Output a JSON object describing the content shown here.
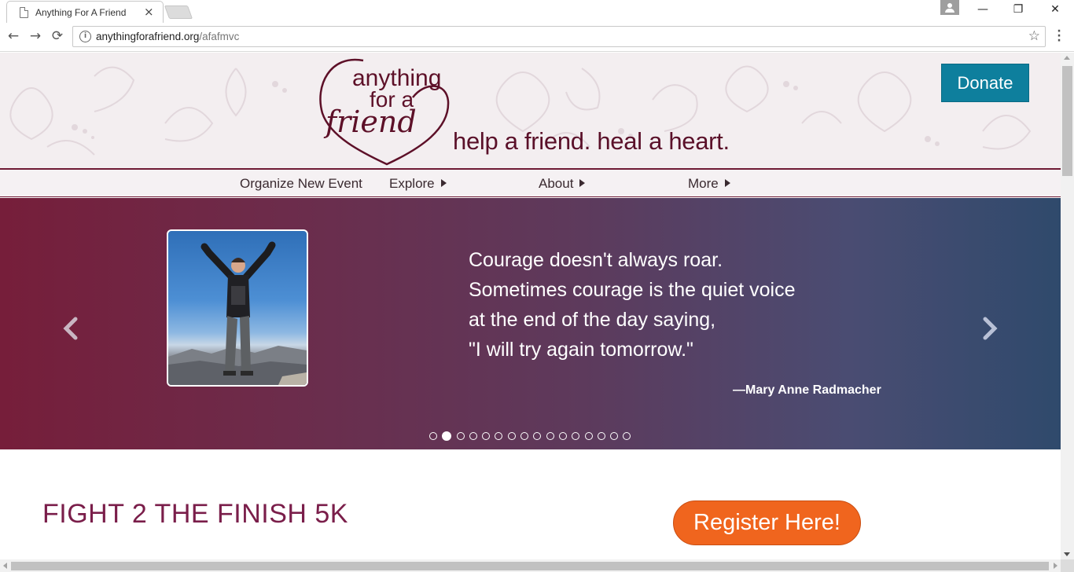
{
  "browser": {
    "tab_title": "Anything For A Friend",
    "close_glyph": "×",
    "url_host": "anythingforafriend.org",
    "url_path": "/afafmvc",
    "info_glyph": "i",
    "star_glyph": "☆",
    "back_glyph": "←",
    "forward_glyph": "→",
    "reload_glyph": "⟳",
    "minimize_glyph": "—",
    "maximize_glyph": "❐",
    "window_close_glyph": "✕"
  },
  "header": {
    "logo": {
      "line1": "anything",
      "line2": "for a",
      "line3": "friend"
    },
    "tagline": "help a friend.  heal a heart.",
    "donate_label": "Donate"
  },
  "nav": {
    "items": [
      {
        "label": "Organize New Event",
        "has_submenu": false
      },
      {
        "label": "Explore",
        "has_submenu": true
      },
      {
        "label": "About",
        "has_submenu": true
      },
      {
        "label": "More",
        "has_submenu": true
      }
    ]
  },
  "hero": {
    "quote_lines": [
      "Courage doesn't always roar.",
      "Sometimes courage is the quiet voice",
      "at the end of the day saying,",
      "\"I will try again tomorrow.\""
    ],
    "author": "—Mary Anne Radmacher",
    "slide_count": 16,
    "active_slide": 2
  },
  "content": {
    "event_title": "FIGHT 2 THE FINISH 5K",
    "register_label": "Register Here!"
  },
  "colors": {
    "brand": "#6e1a34",
    "donate": "#0e7f9d",
    "register": "#f0651e",
    "title": "#7a1e4a"
  },
  "icons": [
    "page-icon",
    "close-icon",
    "back-icon",
    "forward-icon",
    "reload-icon",
    "info-icon",
    "star-icon",
    "menu-icon",
    "chevron-left-icon",
    "chevron-right-icon",
    "caret-right-icon"
  ]
}
